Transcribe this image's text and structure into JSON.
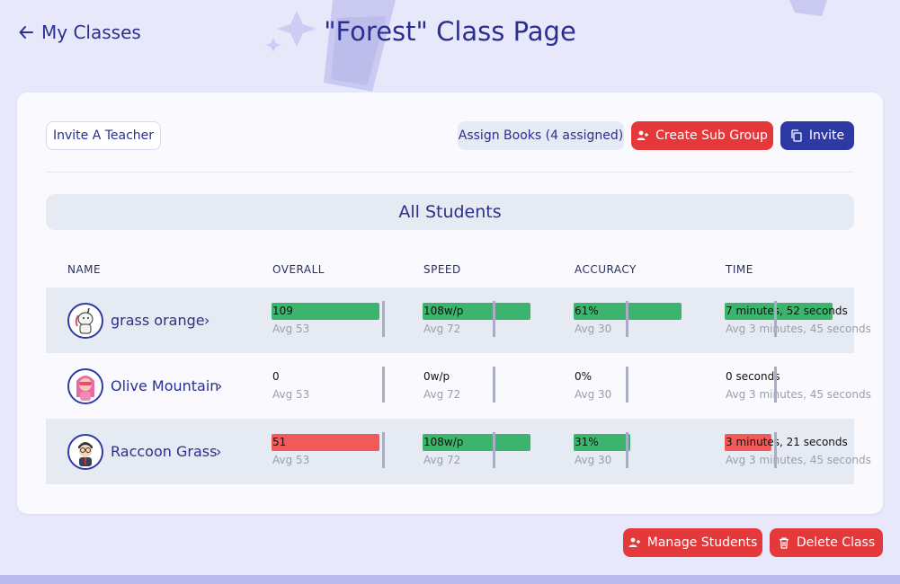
{
  "header": {
    "back_label": "My Classes",
    "title": "\"Forest\" Class Page"
  },
  "toolbar": {
    "invite_teacher": "Invite A Teacher",
    "assign_books": "Assign Books (4 assigned)",
    "create_sub_group": "Create Sub Group",
    "invite": "Invite"
  },
  "section": {
    "title": "All Students"
  },
  "columns": [
    "NAME",
    "OVERALL",
    "SPEED",
    "ACCURACY",
    "TIME"
  ],
  "students": [
    {
      "name": "grass orange",
      "overall": {
        "value": "109",
        "avg": "Avg 53",
        "fill": 1.0,
        "status": "green"
      },
      "speed": {
        "value": "108w/p",
        "avg": "Avg 72",
        "fill": 1.0,
        "status": "green"
      },
      "accuracy": {
        "value": "61%",
        "avg": "Avg 30",
        "fill": 1.0,
        "status": "green"
      },
      "time": {
        "value": "7 minutes, 52 seconds",
        "avg": "Avg 3 minutes, 45 seconds",
        "fill": 1.0,
        "status": "green"
      }
    },
    {
      "name": "Olive Mountain",
      "overall": {
        "value": "0",
        "avg": "Avg 53",
        "fill": 0,
        "status": "none"
      },
      "speed": {
        "value": "0w/p",
        "avg": "Avg 72",
        "fill": 0,
        "status": "none"
      },
      "accuracy": {
        "value": "0%",
        "avg": "Avg 30",
        "fill": 0,
        "status": "none"
      },
      "time": {
        "value": "0 seconds",
        "avg": "Avg 3 minutes, 45 seconds",
        "fill": 0,
        "status": "none"
      }
    },
    {
      "name": "Raccoon Grass",
      "overall": {
        "value": "51",
        "avg": "Avg 53",
        "fill": 1.0,
        "status": "red"
      },
      "speed": {
        "value": "108w/p",
        "avg": "Avg 72",
        "fill": 1.0,
        "status": "green"
      },
      "accuracy": {
        "value": "31%",
        "avg": "Avg 30",
        "fill": 0.53,
        "status": "green"
      },
      "time": {
        "value": "3 minutes, 21 seconds",
        "avg": "Avg 3 minutes, 45 seconds",
        "fill": 0.43,
        "status": "red"
      }
    }
  ],
  "footer": {
    "manage_students": "Manage Students",
    "delete_class": "Delete Class"
  },
  "colors": {
    "green": "#3db46d",
    "red": "#f25a5a",
    "primary": "#2e3aa3",
    "danger": "#e5383b"
  }
}
